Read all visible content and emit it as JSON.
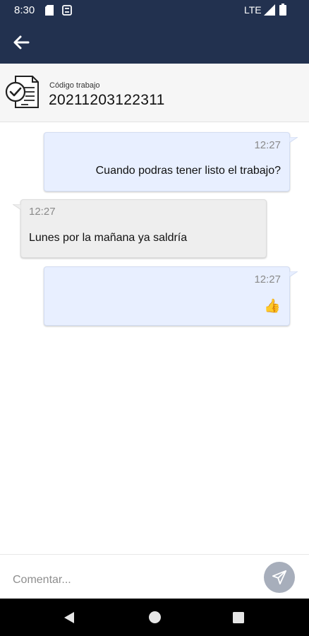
{
  "status_bar": {
    "time": "8:30",
    "network": "LTE"
  },
  "header": {
    "job_label": "Código trabajo",
    "job_code": "20211203122311"
  },
  "messages": [
    {
      "direction": "outgoing",
      "time": "12:27",
      "text": "Cuando podras tener listo el trabajo?"
    },
    {
      "direction": "incoming",
      "time": "12:27",
      "text": "Lunes por la mañana ya saldría"
    },
    {
      "direction": "outgoing",
      "time": "12:27",
      "text": "👍"
    }
  ],
  "composer": {
    "placeholder": "Comentar..."
  },
  "colors": {
    "header_bg": "#22314f",
    "outgoing_bubble": "#e8efff",
    "incoming_bubble": "#eeeeee",
    "send_button": "#a7aebb"
  }
}
